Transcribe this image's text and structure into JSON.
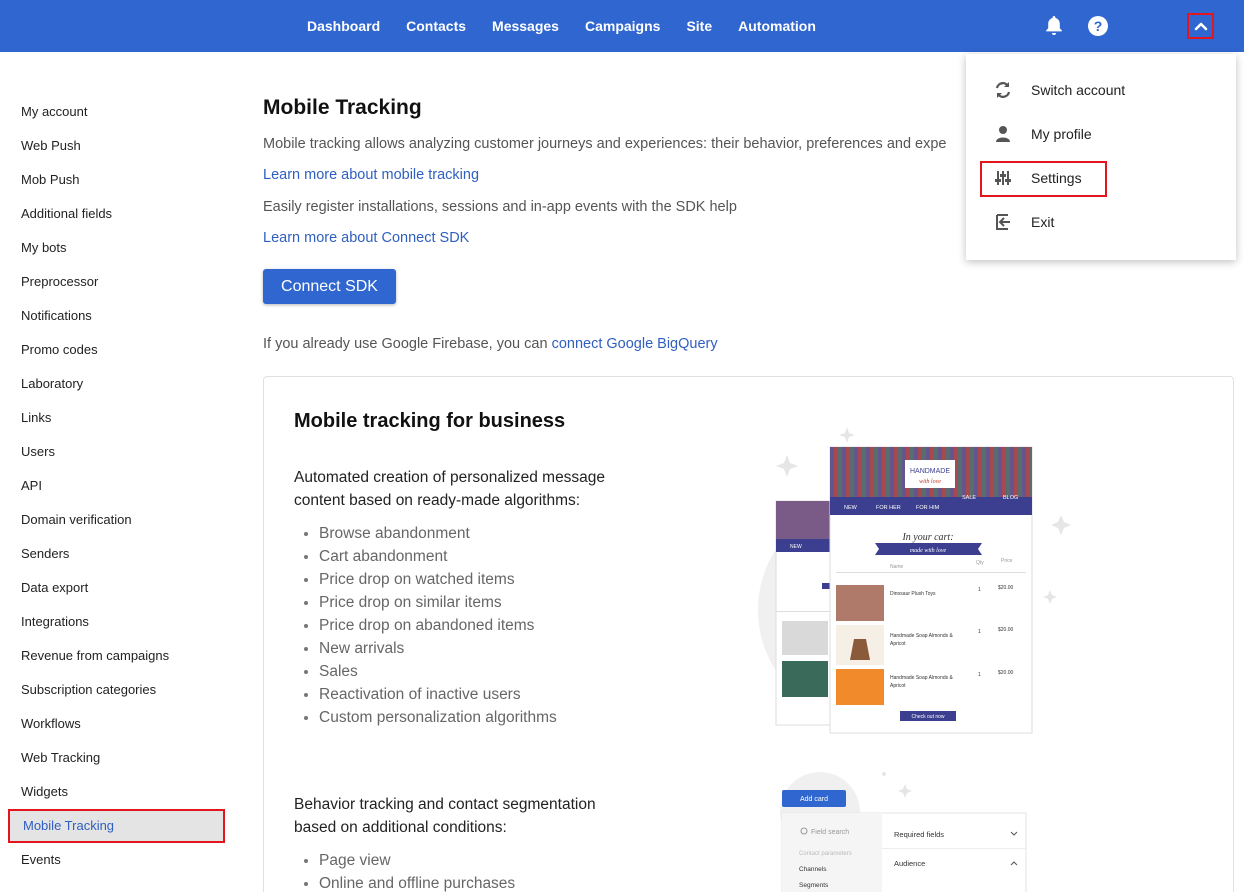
{
  "topnav": {
    "items": [
      "Dashboard",
      "Contacts",
      "Messages",
      "Campaigns",
      "Site",
      "Automation"
    ],
    "icons": [
      "bell-icon",
      "help-icon",
      "chevron-up-icon"
    ]
  },
  "sidebar": {
    "items": [
      "My account",
      "Web Push",
      "Mob Push",
      "Additional fields",
      "My bots",
      "Preprocessor",
      "Notifications",
      "Promo codes",
      "Laboratory",
      "Links",
      "Users",
      "API",
      "Domain verification",
      "Senders",
      "Data export",
      "Integrations",
      "Revenue from campaigns",
      "Subscription categories",
      "Workflows",
      "Web Tracking",
      "Widgets",
      "Mobile Tracking",
      "Events"
    ],
    "active": "Mobile Tracking"
  },
  "main": {
    "title": "Mobile Tracking",
    "desc1": "Mobile tracking allows analyzing customer journeys and experiences: their behavior, preferences and expe",
    "link1": "Learn more about mobile tracking",
    "desc2": "Easily register installations, sessions and in-app events with the SDK help",
    "link2": "Learn more about Connect SDK",
    "button": "Connect SDK",
    "firebase_text": "If you already use Google Firebase, you can ",
    "firebase_link": "connect Google BigQuery"
  },
  "card": {
    "title": "Mobile tracking for business",
    "p1": "Automated creation of personalized message content based on ready-made algorithms:",
    "bullets1": [
      "Browse abandonment",
      "Cart abandonment",
      "Price drop on watched items",
      "Price drop on similar items",
      "Price drop on abandoned items",
      "New arrivals",
      "Sales",
      "Reactivation of inactive users",
      "Custom personalization algorithms"
    ],
    "p2": "Behavior tracking and contact segmentation based on additional conditions:",
    "bullets2": [
      "Page view",
      "Online and offline purchases"
    ]
  },
  "illustration": {
    "brand": "HANDMADE",
    "brand2": "with love",
    "cart_title": "In your cart:",
    "nav": [
      "NEW",
      "FOR HER",
      "FOR HIM",
      "SALE",
      "BLOG"
    ],
    "cols": [
      "Name",
      "Qty",
      "Price"
    ],
    "rows": [
      {
        "name": "Dinosaur Plush Toys",
        "qty": "1",
        "price": "$20.00"
      },
      {
        "name": "Handmade Soap Almonds & Apricot",
        "qty": "1",
        "price": "$20.00"
      },
      {
        "name": "Handmade Soap Almonds & Apricot",
        "qty": "1",
        "price": "$20.00"
      }
    ],
    "checkout": "Check out now",
    "add_card": "Add card",
    "field_search": "Field search",
    "contact_params": "Contact parameters",
    "channels": "Channels",
    "segments": "Segments",
    "required_fields": "Required fields",
    "audience": "Audience"
  },
  "dropdown": {
    "items": [
      "Switch account",
      "My profile",
      "Settings",
      "Exit"
    ]
  },
  "colors": {
    "brand": "#2f66cf",
    "link": "#2f5fc0",
    "highlight": "#e3161d"
  }
}
